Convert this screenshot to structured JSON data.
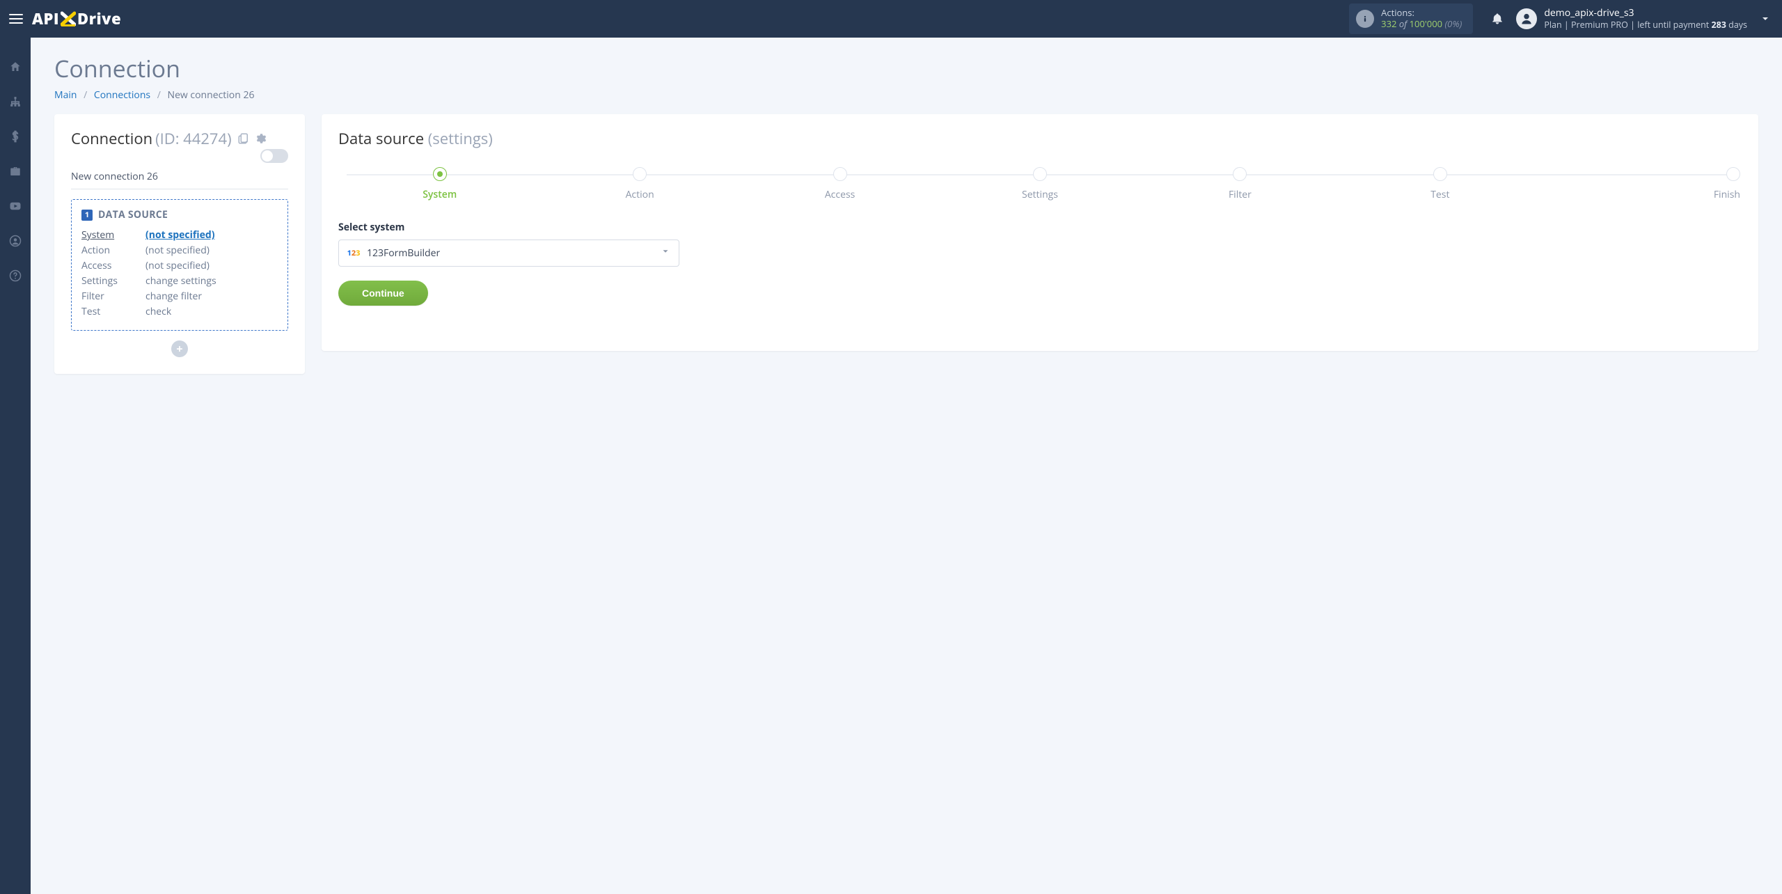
{
  "header": {
    "actions_label": "Actions:",
    "actions_used": "332",
    "actions_of": "of",
    "actions_limit": "100'000",
    "actions_pct": "(0%)",
    "user_name": "demo_apix-drive_s3",
    "user_plan_prefix": "Plan |",
    "user_plan_name": "Premium PRO",
    "user_plan_mid": "| left until payment",
    "user_plan_days_num": "283",
    "user_plan_days_word": "days"
  },
  "page": {
    "title": "Connection",
    "crumbs": {
      "main": "Main",
      "connections": "Connections",
      "current": "New connection 26"
    }
  },
  "left": {
    "heading": "Connection",
    "id_label": "(ID: 44274)",
    "conn_name": "New connection 26",
    "ds_title": "DATA SOURCE",
    "ds_badge": "1",
    "rows": [
      {
        "label": "System",
        "value": "(not specified)",
        "active": true
      },
      {
        "label": "Action",
        "value": "(not specified)",
        "active": false
      },
      {
        "label": "Access",
        "value": "(not specified)",
        "active": false
      },
      {
        "label": "Settings",
        "value": "change settings",
        "active": false
      },
      {
        "label": "Filter",
        "value": "change filter",
        "active": false
      },
      {
        "label": "Test",
        "value": "check",
        "active": false
      }
    ]
  },
  "right": {
    "heading": "Data source",
    "heading_sub": "(settings)",
    "steps": [
      "System",
      "Action",
      "Access",
      "Settings",
      "Filter",
      "Test",
      "Finish"
    ],
    "active_step": 0,
    "select_label": "Select system",
    "select_value": "123FormBuilder",
    "continue": "Continue"
  }
}
